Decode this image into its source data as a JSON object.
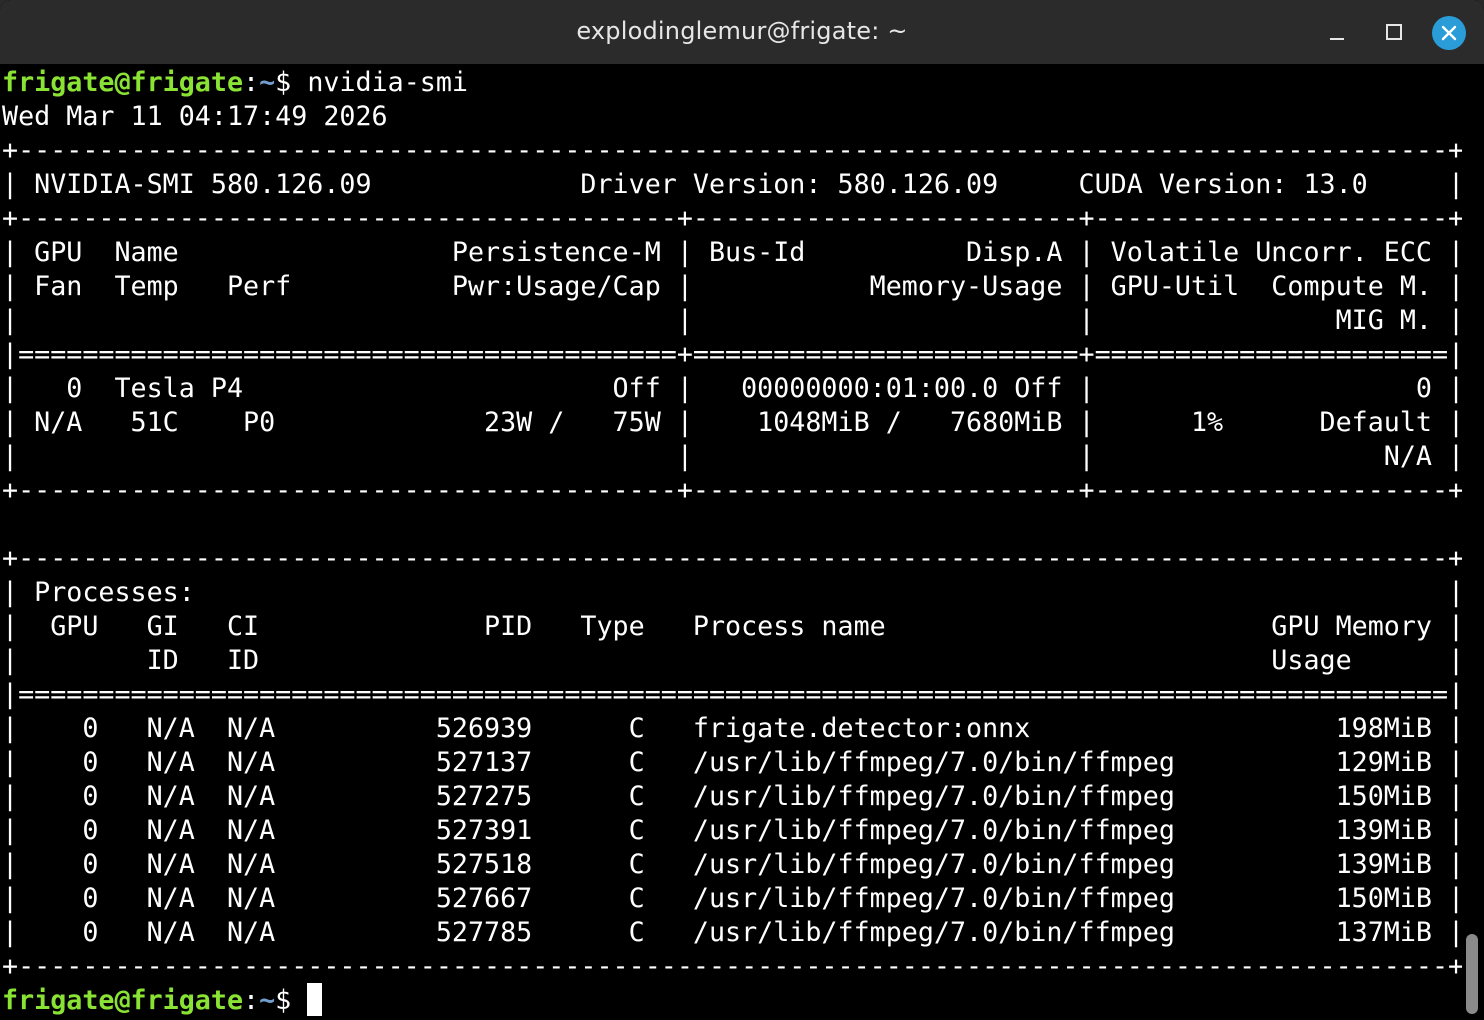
{
  "window": {
    "title": "explodinglemur@frigate: ~"
  },
  "colors": {
    "prompt_user": "#8ae234",
    "prompt_path": "#729fcf",
    "background": "#000000",
    "foreground": "#ffffff",
    "close_button": "#2a9cd8"
  },
  "icons": {
    "minimize": "minimize-icon",
    "maximize": "maximize-icon",
    "close": "close-icon"
  },
  "prompt": {
    "user_host": "frigate@frigate",
    "colon": ":",
    "path": "~",
    "symbol": "$ "
  },
  "command": "nvidia-smi",
  "output": [
    "Wed Mar 11 04:17:49 2026",
    "+-----------------------------------------------------------------------------------------+",
    "| NVIDIA-SMI 580.126.09             Driver Version: 580.126.09     CUDA Version: 13.0     |",
    "+-----------------------------------------+------------------------+----------------------+",
    "| GPU  Name                 Persistence-M | Bus-Id          Disp.A | Volatile Uncorr. ECC |",
    "| Fan  Temp   Perf          Pwr:Usage/Cap |           Memory-Usage | GPU-Util  Compute M. |",
    "|                                         |                        |               MIG M. |",
    "|=========================================+========================+======================|",
    "|   0  Tesla P4                       Off |   00000000:01:00.0 Off |                    0 |",
    "| N/A   51C    P0             23W /   75W |    1048MiB /   7680MiB |      1%      Default |",
    "|                                         |                        |                  N/A |",
    "+-----------------------------------------+------------------------+----------------------+",
    "",
    "+-----------------------------------------------------------------------------------------+",
    "| Processes:                                                                              |",
    "|  GPU   GI   CI              PID   Type   Process name                        GPU Memory |",
    "|        ID   ID                                                               Usage      |",
    "|=========================================================================================|",
    "|    0   N/A  N/A          526939      C   frigate.detector:onnx                   198MiB |",
    "|    0   N/A  N/A          527137      C   /usr/lib/ffmpeg/7.0/bin/ffmpeg          129MiB |",
    "|    0   N/A  N/A          527275      C   /usr/lib/ffmpeg/7.0/bin/ffmpeg          150MiB |",
    "|    0   N/A  N/A          527391      C   /usr/lib/ffmpeg/7.0/bin/ffmpeg          139MiB |",
    "|    0   N/A  N/A          527518      C   /usr/lib/ffmpeg/7.0/bin/ffmpeg          139MiB |",
    "|    0   N/A  N/A          527667      C   /usr/lib/ffmpeg/7.0/bin/ffmpeg          150MiB |",
    "|    0   N/A  N/A          527785      C   /usr/lib/ffmpeg/7.0/bin/ffmpeg          137MiB |",
    "+-----------------------------------------------------------------------------------------+"
  ]
}
